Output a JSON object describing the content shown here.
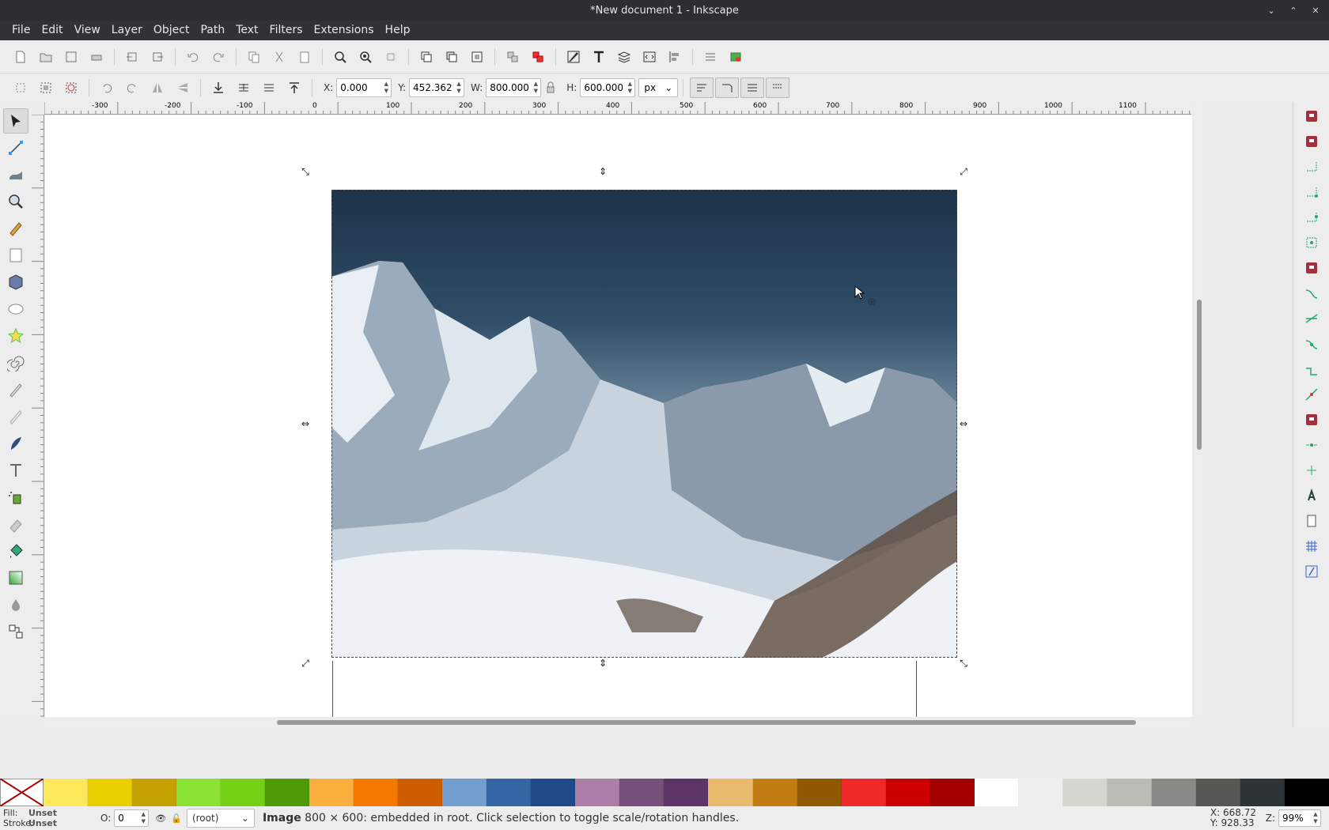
{
  "window": {
    "title": "*New document 1 - Inkscape"
  },
  "menubar": [
    "File",
    "Edit",
    "View",
    "Layer",
    "Object",
    "Path",
    "Text",
    "Filters",
    "Extensions",
    "Help"
  ],
  "controls": {
    "x_label": "X:",
    "x_value": "0.000",
    "y_label": "Y:",
    "y_value": "452.362",
    "w_label": "W:",
    "w_value": "800.000",
    "h_label": "H:",
    "h_value": "600.000",
    "unit": "px"
  },
  "ruler_labels": [
    "-300",
    "-200",
    "-100",
    "0",
    "100",
    "200",
    "300",
    "400",
    "500",
    "600",
    "700",
    "800",
    "900",
    "1000",
    "1100"
  ],
  "palette": [
    "#fde75a",
    "#eacf00",
    "#c4a000",
    "#8ae234",
    "#73d216",
    "#4e9a06",
    "#fcaf3e",
    "#f57900",
    "#ce5c00",
    "#729fcf",
    "#3465a4",
    "#204a87",
    "#ad7fa8",
    "#75507b",
    "#5c3566",
    "#e9b96e",
    "#c17d11",
    "#8f5902",
    "#ef2929",
    "#cc0000",
    "#a40000",
    "#ffffff",
    "#eeeeec",
    "#d3d7cf",
    "#babdb6",
    "#888a85",
    "#555753",
    "#2e3436",
    "#000000"
  ],
  "status": {
    "fill_label": "Fill:",
    "fill_value": "Unset",
    "stroke_label": "Stroke:",
    "stroke_value": "Unset",
    "opacity_label": "O:",
    "opacity_value": "0",
    "layer": "(root)",
    "message_bold": "Image",
    "message": "800 × 600: embedded in root. Click selection to toggle scale/rotation handles.",
    "cursor_x": "X: 668.72",
    "cursor_y": "Y: 928.33",
    "zoom_label": "Z:",
    "zoom_value": "99%"
  }
}
